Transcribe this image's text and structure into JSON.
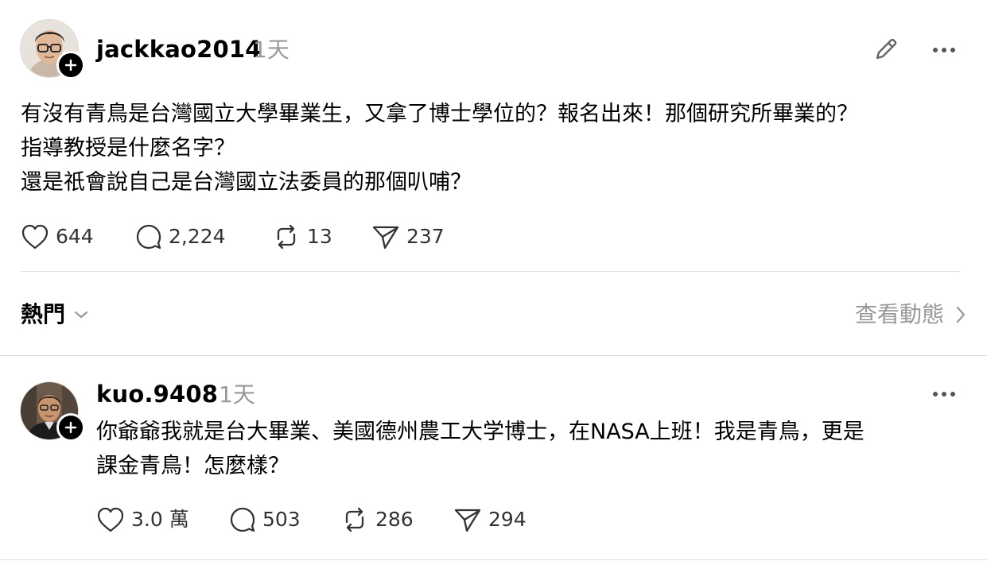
{
  "original_post": {
    "author": {
      "username": "jackkao2014",
      "avatar_icon": "profile-photo-man-glasses",
      "badge_icon": "follow-plus-icon"
    },
    "timestamp": "1天",
    "text_lines": [
      "有沒有青鳥是台灣國立大學畢業生，又拿了博士學位的？報名出來！那個研究所畢業的？",
      "指導教授是什麼名字？",
      "還是祇會說自己是台灣國立法委員的那個叭哺？"
    ],
    "stats": {
      "likes": "644",
      "replies": "2,224",
      "reposts": "13",
      "shares": "237"
    },
    "edit_icon": "pencil-icon",
    "more_icon": "more-horizontal-icon"
  },
  "sort_bar": {
    "sort_label": "熱門",
    "activity_label": "查看動態"
  },
  "reply": {
    "author": {
      "username": "kuo.9408",
      "avatar_icon": "profile-photo-man-jacket",
      "badge_icon": "follow-plus-icon"
    },
    "timestamp": "1天",
    "text_lines": [
      "你爺爺我就是台大畢業、美國德州農工大学博士，在NASA上班！我是青鳥，更是",
      "課金青鳥！怎麼樣？"
    ],
    "stats": {
      "likes": "3.0 萬",
      "replies": "503",
      "reposts": "286",
      "shares": "294"
    },
    "more_icon": "more-horizontal-icon"
  },
  "colors": {
    "text": "#000000",
    "secondary_text": "#999999",
    "count_text": "#333333",
    "divider": "#dcdcdc",
    "background": "#ffffff"
  }
}
